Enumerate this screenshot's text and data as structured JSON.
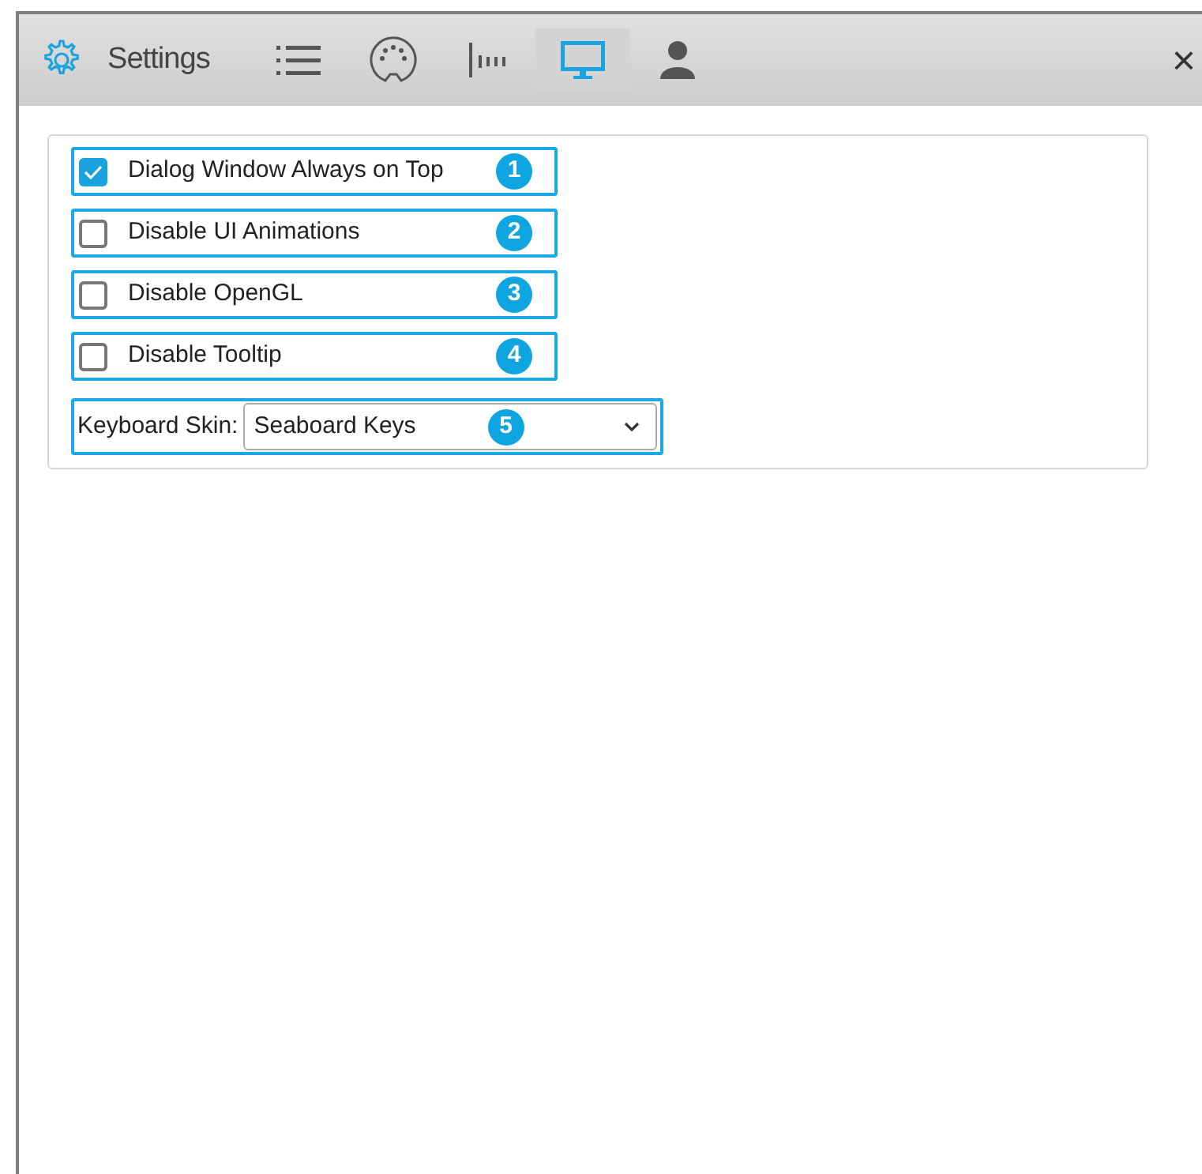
{
  "header": {
    "title": "Settings",
    "tabs": [
      {
        "kind": "list",
        "selected": false
      },
      {
        "kind": "midi",
        "selected": false
      },
      {
        "kind": "meter",
        "selected": false
      },
      {
        "kind": "display",
        "selected": true
      },
      {
        "kind": "user",
        "selected": false
      }
    ],
    "close": "×"
  },
  "options": [
    {
      "label": "Dialog Window Always on Top",
      "checked": true,
      "callout": "1"
    },
    {
      "label": "Disable UI Animations",
      "checked": false,
      "callout": "2"
    },
    {
      "label": "Disable OpenGL",
      "checked": false,
      "callout": "3"
    },
    {
      "label": "Disable Tooltip",
      "checked": false,
      "callout": "4"
    }
  ],
  "skin": {
    "label": "Keyboard Skin:",
    "value": "Seaboard Keys",
    "callout": "5"
  }
}
